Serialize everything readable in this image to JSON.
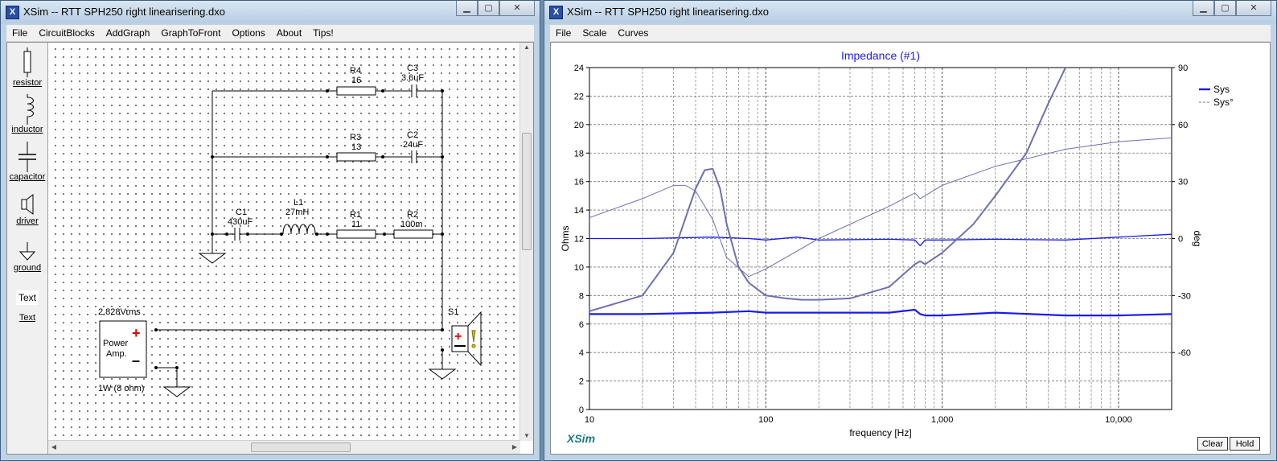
{
  "left_window": {
    "title": "XSim -- RTT SPH250 right linearisering.dxo",
    "app_icon": "X",
    "menu": [
      "File",
      "CircuitBlocks",
      "AddGraph",
      "GraphToFront",
      "Options",
      "About",
      "Tips!"
    ],
    "tools": [
      {
        "label": "resistor",
        "icon": "resistor-icon"
      },
      {
        "label": "inductor",
        "icon": "inductor-icon"
      },
      {
        "label": "capacitor",
        "icon": "capacitor-icon"
      },
      {
        "label": "driver",
        "icon": "speaker-icon"
      },
      {
        "label": "ground",
        "icon": "ground-icon"
      },
      {
        "label": "Text",
        "icon": "text-icon",
        "icon_text": "Text"
      }
    ],
    "components": {
      "r4": {
        "name": "R4",
        "value": "16"
      },
      "c3": {
        "name": "C3",
        "value": "3.6uF"
      },
      "r3": {
        "name": "R3",
        "value": "13"
      },
      "c2": {
        "name": "C2",
        "value": "24uF"
      },
      "c1": {
        "name": "C1",
        "value": "430uF"
      },
      "l1": {
        "name": "L1",
        "value": "27mH"
      },
      "r1": {
        "name": "R1",
        "value": "11"
      },
      "r2": {
        "name": "R2",
        "value": "100m"
      },
      "amp": {
        "voltage": "2.828Vrms",
        "label_line1": "Power",
        "label_line2": "Amp.",
        "plus": "+",
        "minus": "–",
        "power": "1W (8 ohm)"
      },
      "driver": {
        "name": "S1"
      }
    }
  },
  "right_window": {
    "title": "XSim -- RTT SPH250 right linearisering.dxo",
    "app_icon": "X",
    "menu": [
      "File",
      "Scale",
      "Curves"
    ],
    "brand": "XSim",
    "buttons": {
      "clear": "Clear",
      "hold": "Hold"
    },
    "colors": {
      "curve": "#1a1aee",
      "title": "#1a1aee",
      "brand": "#1c7a85",
      "phase": "#7070b0"
    }
  },
  "window_controls": {
    "minimize": "▁",
    "maximize": "▢",
    "close": "✕"
  },
  "chart_data": {
    "type": "line",
    "title": "Impedance (#1)",
    "xlabel": "frequency [Hz]",
    "ylabel": "Ohms",
    "y2label": "deg",
    "xscale": "log",
    "xlim": [
      10,
      20000
    ],
    "ylim": [
      0,
      24
    ],
    "y2lim": [
      -90,
      90
    ],
    "x_tick_labels": [
      "10",
      "100",
      "1,000",
      "10,000"
    ],
    "x_ticks": [
      10,
      100,
      1000,
      10000
    ],
    "y_ticks": [
      0,
      2,
      4,
      6,
      8,
      10,
      12,
      14,
      16,
      18,
      20,
      22,
      24
    ],
    "y2_ticks": [
      -60,
      -30,
      0,
      30,
      60,
      90
    ],
    "grid": true,
    "legend": {
      "placement": "top-right",
      "entries": [
        "Sys",
        "Sys°"
      ]
    },
    "series": [
      {
        "name": "Sys",
        "axis": "left",
        "style": "solid",
        "x": [
          10,
          20,
          50,
          80,
          100,
          200,
          500,
          700,
          750,
          800,
          1000,
          2000,
          5000,
          10000,
          20000
        ],
        "y": [
          6.7,
          6.7,
          6.8,
          6.9,
          6.8,
          6.8,
          6.8,
          7.0,
          6.7,
          6.6,
          6.6,
          6.8,
          6.6,
          6.6,
          6.7
        ]
      },
      {
        "name": "Sys",
        "axis": "left",
        "style": "solid",
        "x": [
          10,
          20,
          50,
          80,
          100,
          150,
          200,
          500,
          700,
          750,
          800,
          1000,
          2000,
          5000,
          10000,
          20000
        ],
        "y": [
          12.0,
          12.0,
          12.1,
          12.0,
          11.9,
          12.1,
          11.9,
          11.95,
          11.9,
          11.5,
          11.9,
          11.9,
          11.95,
          11.9,
          12.1,
          12.3
        ]
      },
      {
        "name": "Sys",
        "axis": "left",
        "style": "solid",
        "x": [
          10,
          20,
          30,
          40,
          45,
          50,
          55,
          60,
          70,
          80,
          100,
          130,
          160,
          200,
          300,
          500,
          700,
          750,
          800,
          1000,
          1500,
          2000,
          3000,
          4000,
          5000,
          5500
        ],
        "y": [
          6.9,
          8.0,
          11.0,
          15.5,
          16.8,
          16.9,
          15.5,
          13.0,
          10.0,
          8.9,
          8.0,
          7.8,
          7.7,
          7.7,
          7.8,
          8.6,
          10.2,
          10.4,
          10.2,
          11.0,
          13.0,
          15.0,
          18.0,
          21.5,
          24.0,
          25.0
        ]
      },
      {
        "name": "Sys°",
        "axis": "right",
        "style": "dashed",
        "x": [
          10,
          20,
          30,
          35,
          40,
          50,
          60,
          80,
          100,
          200,
          500,
          700,
          750,
          1000,
          2000,
          5000,
          10000,
          20000
        ],
        "y": [
          11,
          21,
          28,
          28,
          25,
          10,
          -10,
          -20,
          -16,
          0,
          17,
          24,
          21,
          28,
          38,
          47,
          51,
          53
        ]
      }
    ]
  }
}
